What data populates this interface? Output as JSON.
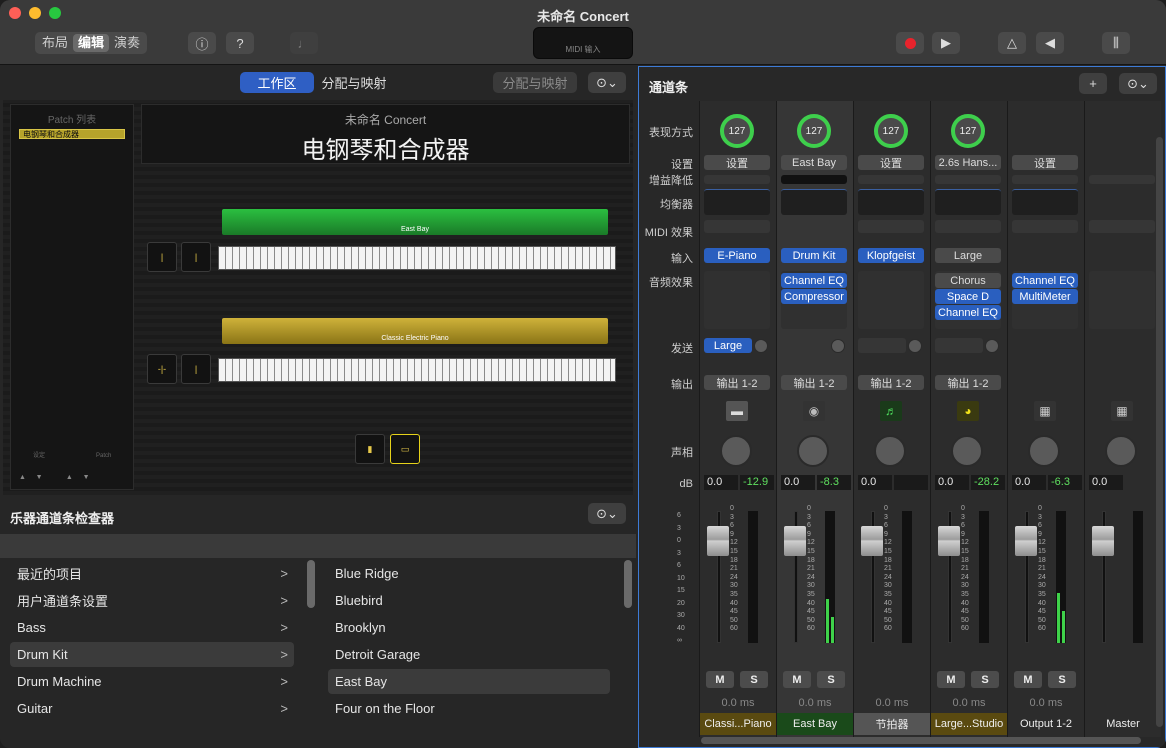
{
  "window": {
    "title": "未命名 Concert"
  },
  "toolbar": {
    "modes": [
      "布局",
      "编辑",
      "演奏"
    ],
    "info": "ⓘ",
    "help": "?",
    "lcd_label": "MIDI 输入"
  },
  "left": {
    "tab_workspace": "工作区",
    "tab_mapping": "分配与映射",
    "mapping_btn": "分配与映射",
    "patch_list_title": "Patch 列表",
    "patch_item": "电钢琴和合成器",
    "patch_footer_left": "设定",
    "patch_footer_right": "Patch",
    "concert_title": "未命名 Concert",
    "patch_title": "电钢琴和合成器",
    "kb1_label": "East Bay",
    "kb2_label": "Classic Electric Piano"
  },
  "inspector": {
    "title": "乐器通道条检查器",
    "categories": [
      {
        "label": "最近的项目"
      },
      {
        "label": "用户通道条设置"
      },
      {
        "label": "Bass"
      },
      {
        "label": "Drum Kit"
      },
      {
        "label": "Drum Machine"
      },
      {
        "label": "Guitar"
      }
    ],
    "presets": [
      {
        "label": "Blue Ridge"
      },
      {
        "label": "Bluebird"
      },
      {
        "label": "Brooklyn"
      },
      {
        "label": "Detroit Garage"
      },
      {
        "label": "East Bay"
      },
      {
        "label": "Four on the Floor"
      }
    ]
  },
  "mixer": {
    "title": "通道条",
    "labels": {
      "display": "表现方式",
      "setting": "设置",
      "gain": "增益降低",
      "eq": "均衡器",
      "midi": "MIDI 效果",
      "input": "输入",
      "audio": "音频效果",
      "send": "发送",
      "output": "输出",
      "pan": "声相",
      "db": "dB"
    },
    "strips": [
      {
        "name": "Classi...Piano",
        "knob": "127",
        "setting": "设置",
        "input": "E-Piano",
        "fx": [],
        "send": "Large",
        "output": "输出 1-2",
        "vol": "0.0",
        "peak": "-12.9",
        "m": "M",
        "s": "S",
        "delay": "0.0 ms"
      },
      {
        "name": "East Bay",
        "knob": "127",
        "setting": "East Bay",
        "input": "Drum Kit",
        "fx": [
          "Channel EQ",
          "Compressor"
        ],
        "send": "",
        "output": "输出 1-2",
        "vol": "0.0",
        "peak": "-8.3",
        "m": "M",
        "s": "S",
        "delay": "0.0 ms"
      },
      {
        "name": "节拍器",
        "knob": "127",
        "setting": "设置",
        "input": "Klopfgeist",
        "fx": [],
        "send": "",
        "output": "输出 1-2",
        "vol": "0.0",
        "peak": "",
        "m": "",
        "s": "",
        "delay": "0.0 ms"
      },
      {
        "name": "Large...Studio",
        "knob": "127",
        "setting": "2.6s Hans...",
        "input": "Large",
        "fx": [
          "Chorus",
          "Space D",
          "Channel EQ"
        ],
        "send": "",
        "output": "输出 1-2",
        "vol": "0.0",
        "peak": "-28.2",
        "m": "M",
        "s": "S",
        "delay": "0.0 ms"
      },
      {
        "name": "Output 1-2",
        "knob": "",
        "setting": "设置",
        "input": "",
        "fx": [
          "Channel EQ",
          "MultiMeter"
        ],
        "send": "",
        "output": "",
        "vol": "0.0",
        "peak": "-6.3",
        "m": "M",
        "s": "S",
        "delay": "0.0 ms"
      },
      {
        "name": "Master",
        "knob": "",
        "setting": "",
        "input": "",
        "fx": [],
        "send": "",
        "output": "",
        "vol": "0.0",
        "peak": "",
        "m": "",
        "s": "",
        "delay": ""
      }
    ],
    "scale": [
      "0",
      "3",
      "6",
      "9",
      "12",
      "15",
      "18",
      "21",
      "24",
      "30",
      "35",
      "40",
      "45",
      "50",
      "60"
    ]
  },
  "colors": {
    "accent": "#2a5fbf",
    "knob": "#3ecf4c",
    "selection": "#2f5fc4"
  }
}
